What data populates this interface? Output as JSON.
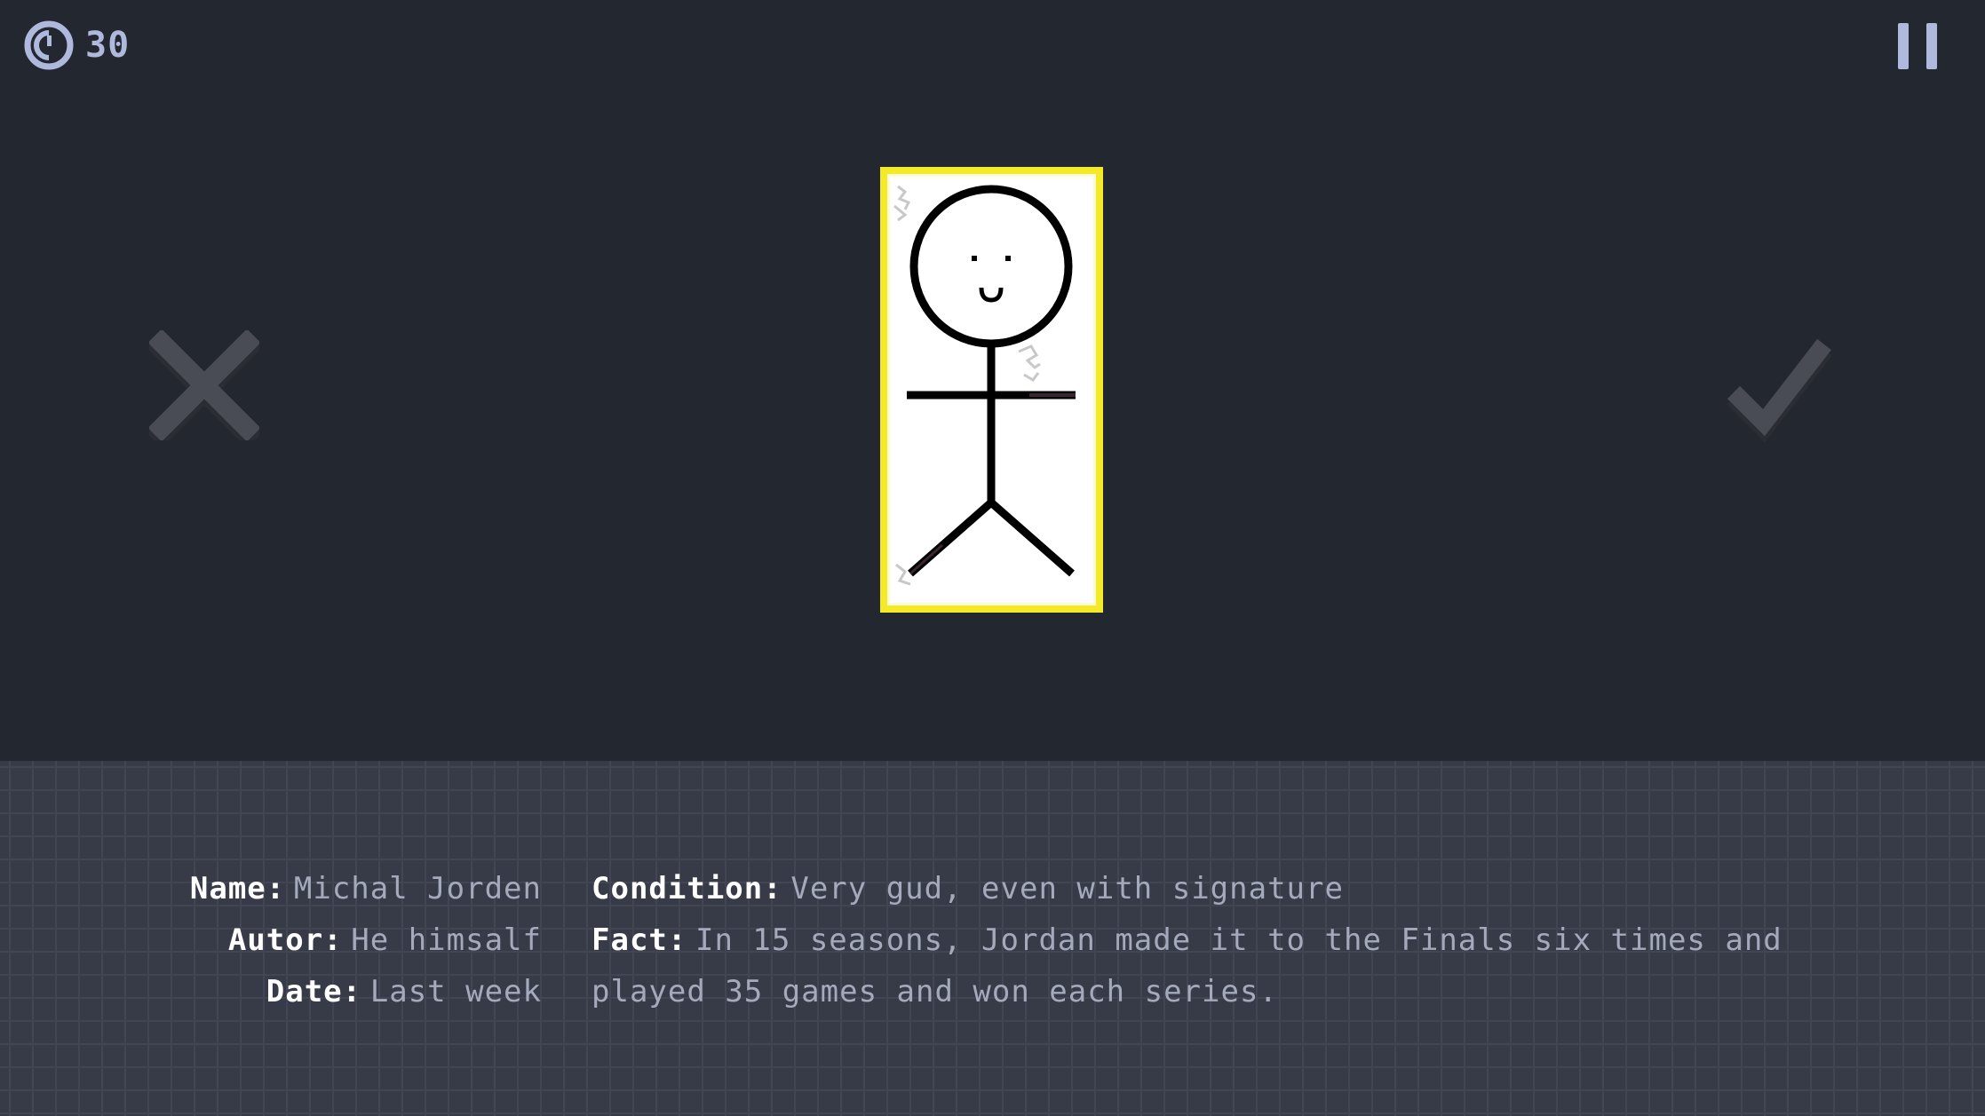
{
  "hud": {
    "timer_icon": "clock-icon",
    "time_left": "30",
    "pause_icon": "pause-icon"
  },
  "actions": {
    "reject_icon": "x-icon",
    "accept_icon": "checkmark-icon"
  },
  "card": {
    "image": "stick-figure-drawing",
    "frame_color": "#f4ea2a"
  },
  "info": {
    "name_label": "Name:",
    "name_value": "Michal Jorden",
    "autor_label": "Autor:",
    "autor_value": "He himsalf",
    "date_label": "Date:",
    "date_value": "Last week",
    "condition_label": "Condition:",
    "condition_value": "Very gud, even with signature",
    "fact_label": "Fact:",
    "fact_value": "In 15 seasons, Jordan made it to the Finals six times and played 35 games and won each series."
  },
  "colors": {
    "background": "#23272f",
    "panel": "#363b47",
    "hud_text": "#aeb9dd",
    "value_text": "#a4aabb"
  }
}
